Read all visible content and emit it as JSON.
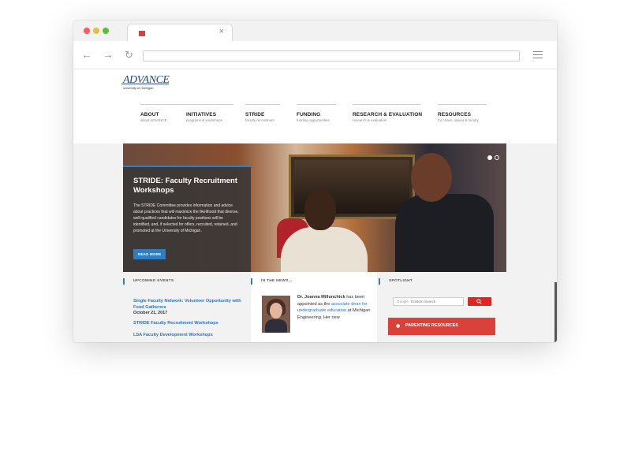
{
  "browser": {
    "tab_title": "",
    "tab_close": "×",
    "url": "",
    "back_icon": "arrow-left-icon",
    "forward_icon": "arrow-right-icon",
    "reload_icon": "reload-icon",
    "menu_icon": "hamburger-icon"
  },
  "site": {
    "logo_main": "ADVANCE",
    "logo_sub": "university of michigan",
    "nav": [
      {
        "label": "ABOUT",
        "desc": "about ADVANCE"
      },
      {
        "label": "INITIATIVES",
        "desc": "programs & workshops"
      },
      {
        "label": "STRIDE",
        "desc": "faculty recruitment"
      },
      {
        "label": "FUNDING",
        "desc": "funding opportunities"
      },
      {
        "label": "RESEARCH & EVALUATION",
        "desc": "research & evaluation"
      },
      {
        "label": "RESOURCES",
        "desc": "for chairs, deans & faculty"
      }
    ]
  },
  "hero": {
    "title": "STRIDE: Faculty Recruitment Workshops",
    "body": "The STRIDE Committee provides information and advice about practices that will maximize the likelihood that diverse, well-qualified candidates for faculty positions will be identified, and, if selected for offers, recruited, retained, and promoted at the University of Michigan.",
    "button": "READ MORE"
  },
  "events": {
    "heading": "UPCOMING EVENTS",
    "items": [
      {
        "title": "Single Faculty Network: Volunteer Opportunity with Food Gatherers",
        "date": "October 21, 2017"
      },
      {
        "title": "STRIDE Faculty Recruitment Workshops",
        "date": ""
      },
      {
        "title": "LSA Faculty Development Workshops",
        "date": ""
      }
    ]
  },
  "news": {
    "heading": "IN THE NEWS...",
    "name": "Dr. Joanna Millunchick",
    "text1": "has been appointed as the",
    "link": "associate dean for undergraduate education",
    "text2": "at Michigan Engineering. Her new"
  },
  "spotlight": {
    "heading": "SPOTLIGHT",
    "search_brand": "Google",
    "search_placeholder": "Custom Search",
    "parenting": "PARENTING RESOURCES"
  },
  "colors": {
    "accent_blue": "#2f7ec2",
    "link_blue": "#2a73c4",
    "brand_red": "#d9413a"
  }
}
